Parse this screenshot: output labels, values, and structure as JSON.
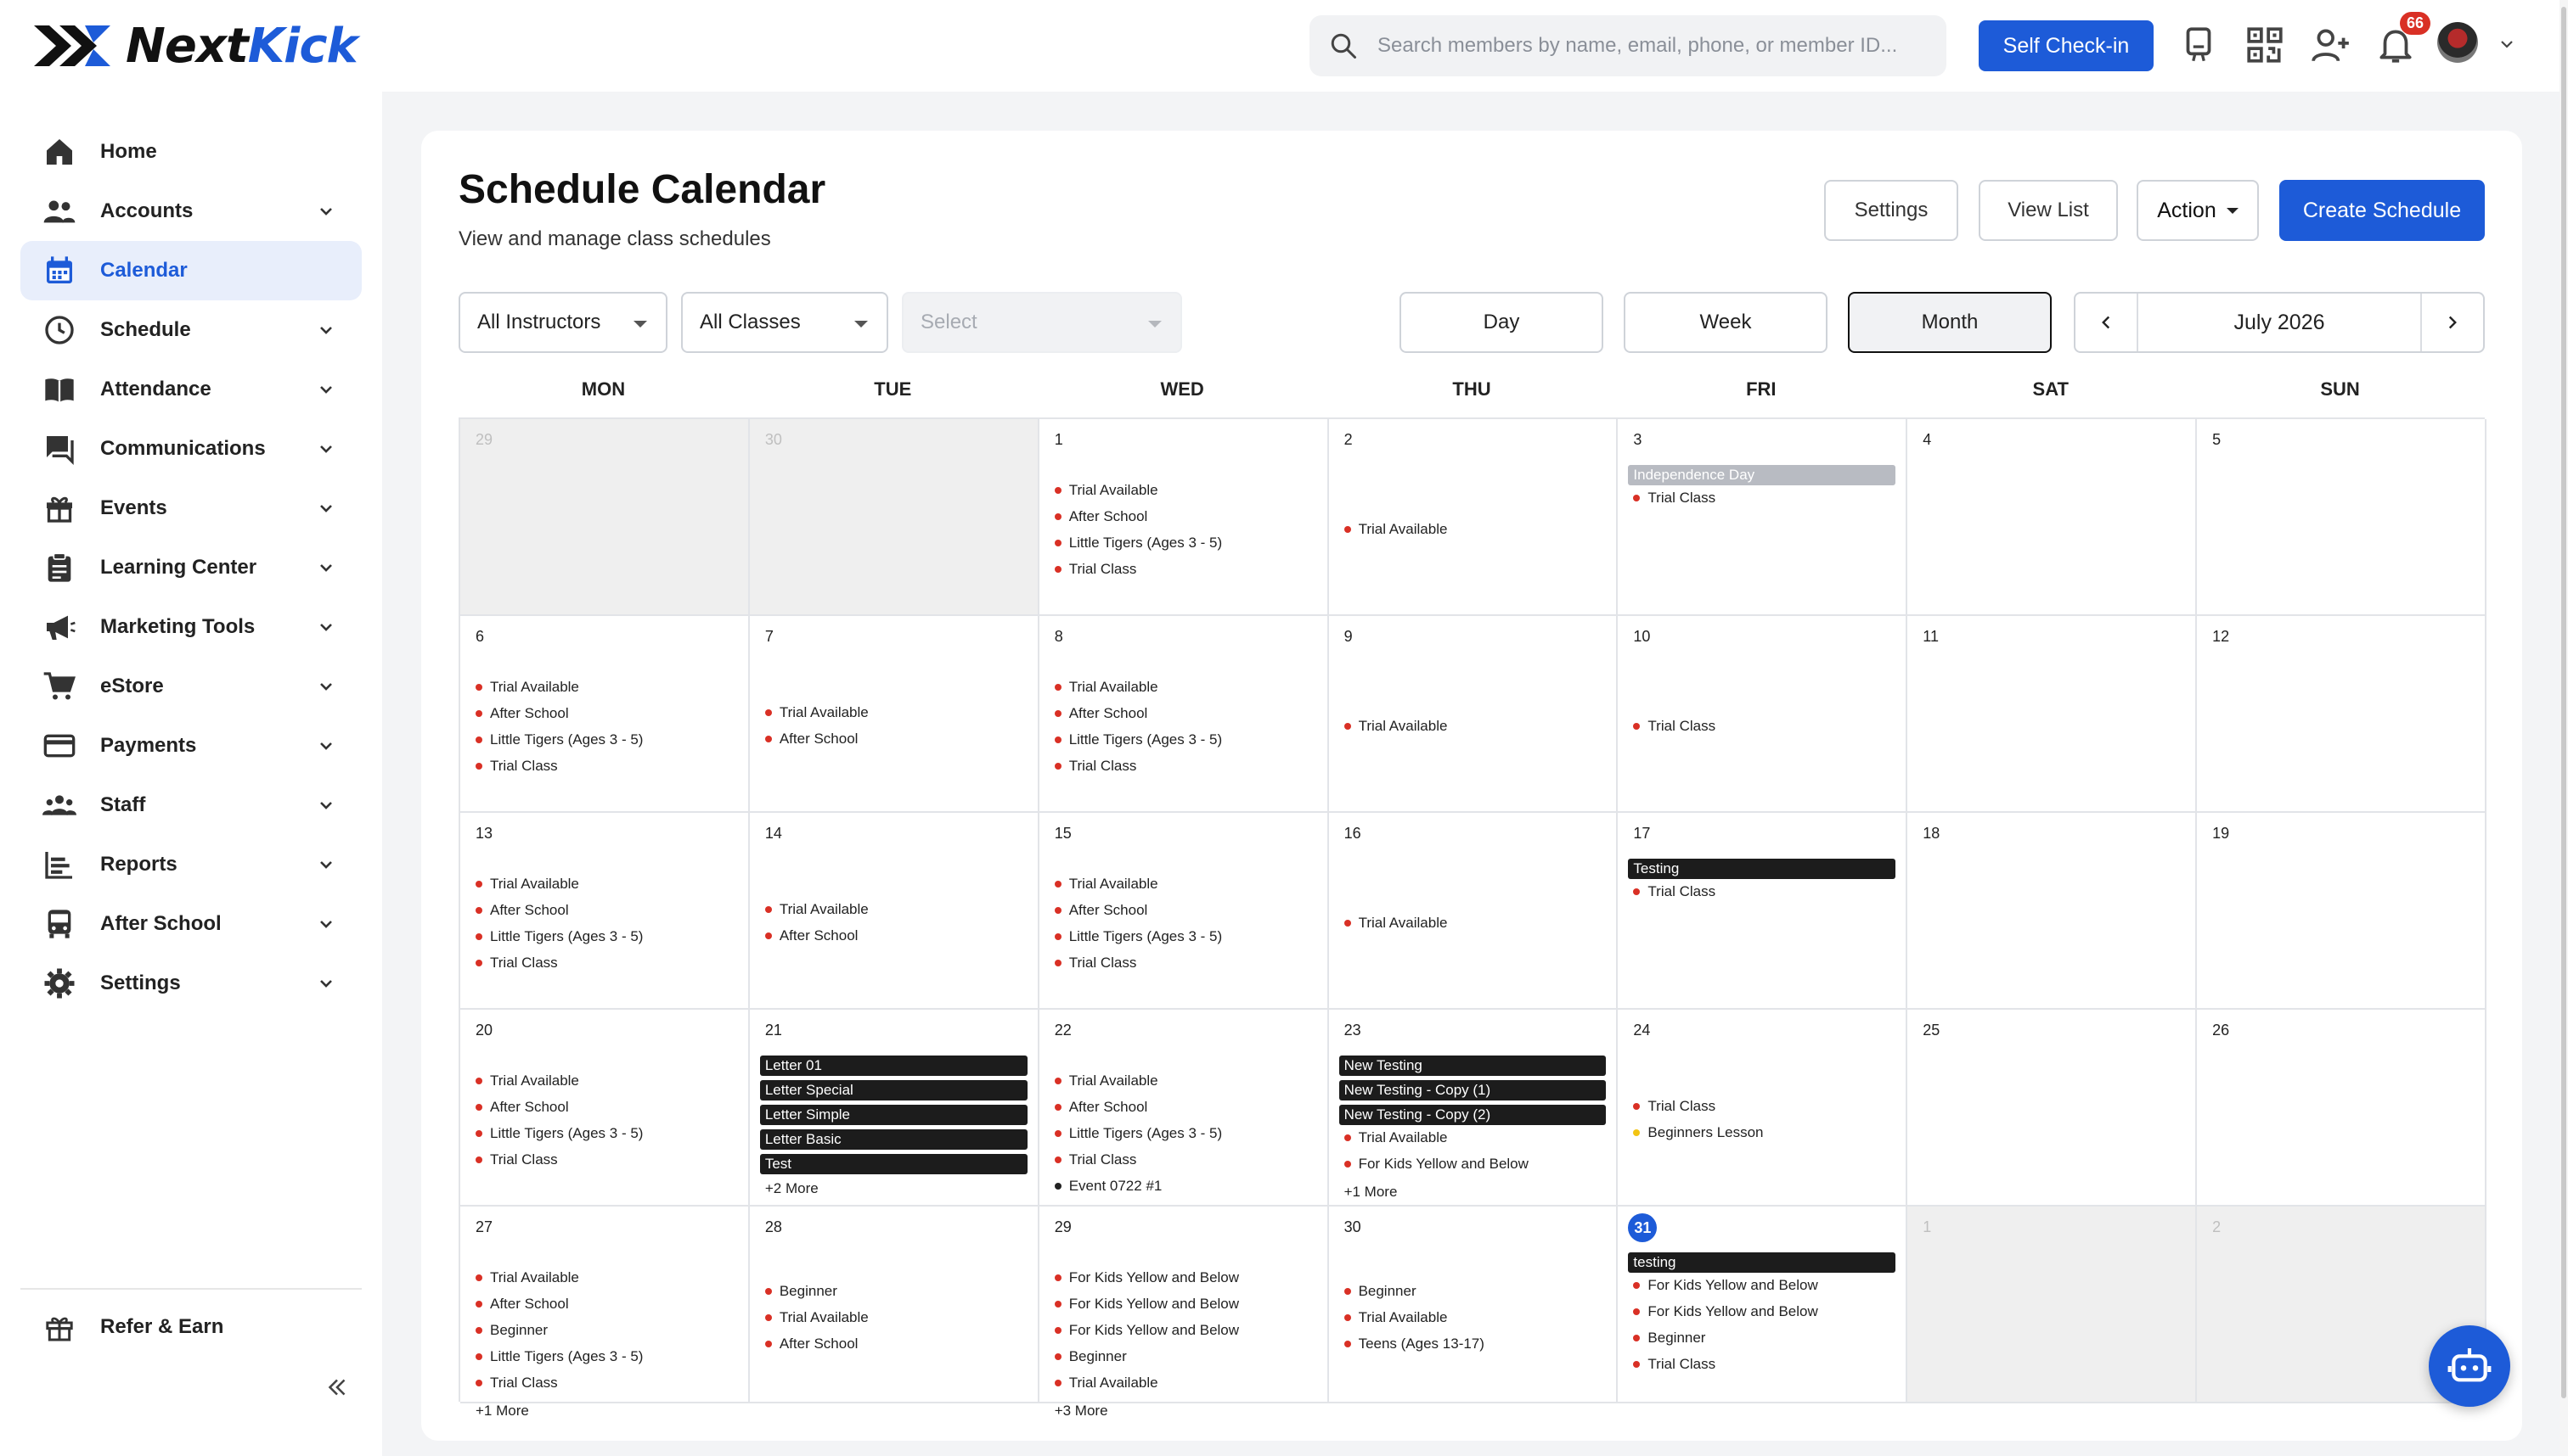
{
  "brand": {
    "name_part1": "Next",
    "name_part2": "Kick",
    "accent": "#1d5bd8"
  },
  "search": {
    "placeholder": "Search members by name, email, phone, or member ID..."
  },
  "topbar": {
    "checkin_label": "Self Check-in",
    "notifications_count": "66"
  },
  "sidebar": {
    "items": [
      {
        "label": "Home",
        "icon": "home-icon",
        "active": false,
        "expandable": false
      },
      {
        "label": "Accounts",
        "icon": "people-icon",
        "active": false,
        "expandable": true
      },
      {
        "label": "Calendar",
        "icon": "calendar-icon",
        "active": true,
        "expandable": false
      },
      {
        "label": "Schedule",
        "icon": "clock-icon",
        "active": false,
        "expandable": true
      },
      {
        "label": "Attendance",
        "icon": "book-icon",
        "active": false,
        "expandable": true
      },
      {
        "label": "Communications",
        "icon": "chat-icon",
        "active": false,
        "expandable": true
      },
      {
        "label": "Events",
        "icon": "gift-icon",
        "active": false,
        "expandable": true
      },
      {
        "label": "Learning Center",
        "icon": "clipboard-icon",
        "active": false,
        "expandable": true
      },
      {
        "label": "Marketing Tools",
        "icon": "megaphone-icon",
        "active": false,
        "expandable": true
      },
      {
        "label": "eStore",
        "icon": "cart-icon",
        "active": false,
        "expandable": true
      },
      {
        "label": "Payments",
        "icon": "card-icon",
        "active": false,
        "expandable": true
      },
      {
        "label": "Staff",
        "icon": "staff-icon",
        "active": false,
        "expandable": true
      },
      {
        "label": "Reports",
        "icon": "reports-icon",
        "active": false,
        "expandable": true
      },
      {
        "label": "After School",
        "icon": "bus-icon",
        "active": false,
        "expandable": true
      },
      {
        "label": "Settings",
        "icon": "gear-icon",
        "active": false,
        "expandable": true
      }
    ],
    "refer_label": "Refer & Earn"
  },
  "page": {
    "title": "Schedule Calendar",
    "subtitle": "View and manage class schedules",
    "settings_label": "Settings",
    "view_list_label": "View List",
    "action_label": "Action",
    "create_label": "Create Schedule"
  },
  "filters": {
    "instructors": "All Instructors",
    "classes": "All Classes",
    "third": "Select"
  },
  "views": {
    "day": "Day",
    "week": "Week",
    "month": "Month",
    "active": "month"
  },
  "month_label": "July 2026",
  "weekdays": [
    "MON",
    "TUE",
    "WED",
    "THU",
    "FRI",
    "SAT",
    "SUN"
  ],
  "weeks": [
    [
      {
        "day": "29",
        "out": true,
        "events": []
      },
      {
        "day": "30",
        "out": true,
        "events": []
      },
      {
        "day": "1",
        "events": [
          {
            "t": "dot",
            "label": "Trial Available"
          },
          {
            "t": "dot",
            "label": "After School"
          },
          {
            "t": "dot",
            "label": "Little Tigers (Ages 3 - 5)"
          },
          {
            "t": "dot",
            "label": "Trial Class"
          }
        ]
      },
      {
        "day": "2",
        "events": [
          {
            "t": "dot",
            "label": "Trial Available"
          }
        ]
      },
      {
        "day": "3",
        "events": [
          {
            "t": "bar",
            "style": "gray",
            "label": "Independence Day"
          },
          {
            "t": "dot",
            "label": "Trial Class"
          }
        ]
      },
      {
        "day": "4",
        "events": []
      },
      {
        "day": "5",
        "events": []
      }
    ],
    [
      {
        "day": "6",
        "events": [
          {
            "t": "dot",
            "label": "Trial Available"
          },
          {
            "t": "dot",
            "label": "After School"
          },
          {
            "t": "dot",
            "label": "Little Tigers (Ages 3 - 5)"
          },
          {
            "t": "dot",
            "label": "Trial Class"
          }
        ]
      },
      {
        "day": "7",
        "events": [
          {
            "t": "dot",
            "label": "Trial Available"
          },
          {
            "t": "dot",
            "label": "After School"
          }
        ]
      },
      {
        "day": "8",
        "events": [
          {
            "t": "dot",
            "label": "Trial Available"
          },
          {
            "t": "dot",
            "label": "After School"
          },
          {
            "t": "dot",
            "label": "Little Tigers (Ages 3 - 5)"
          },
          {
            "t": "dot",
            "label": "Trial Class"
          }
        ]
      },
      {
        "day": "9",
        "events": [
          {
            "t": "dot",
            "label": "Trial Available"
          }
        ]
      },
      {
        "day": "10",
        "events": [
          {
            "t": "dot",
            "label": "Trial Class"
          }
        ]
      },
      {
        "day": "11",
        "events": []
      },
      {
        "day": "12",
        "events": []
      }
    ],
    [
      {
        "day": "13",
        "events": [
          {
            "t": "dot",
            "label": "Trial Available"
          },
          {
            "t": "dot",
            "label": "After School"
          },
          {
            "t": "dot",
            "label": "Little Tigers (Ages 3 - 5)"
          },
          {
            "t": "dot",
            "label": "Trial Class"
          }
        ]
      },
      {
        "day": "14",
        "events": [
          {
            "t": "dot",
            "label": "Trial Available"
          },
          {
            "t": "dot",
            "label": "After School"
          }
        ]
      },
      {
        "day": "15",
        "events": [
          {
            "t": "dot",
            "label": "Trial Available"
          },
          {
            "t": "dot",
            "label": "After School"
          },
          {
            "t": "dot",
            "label": "Little Tigers (Ages 3 - 5)"
          },
          {
            "t": "dot",
            "label": "Trial Class"
          }
        ]
      },
      {
        "day": "16",
        "events": [
          {
            "t": "dot",
            "label": "Trial Available"
          }
        ]
      },
      {
        "day": "17",
        "events": [
          {
            "t": "bar",
            "label": "Testing"
          },
          {
            "t": "dot",
            "label": "Trial Class"
          }
        ]
      },
      {
        "day": "18",
        "events": []
      },
      {
        "day": "19",
        "events": []
      }
    ],
    [
      {
        "day": "20",
        "events": [
          {
            "t": "dot",
            "label": "Trial Available"
          },
          {
            "t": "dot",
            "label": "After School"
          },
          {
            "t": "dot",
            "label": "Little Tigers (Ages 3 - 5)"
          },
          {
            "t": "dot",
            "label": "Trial Class"
          }
        ]
      },
      {
        "day": "21",
        "events": [
          {
            "t": "bar",
            "label": "Letter 01"
          },
          {
            "t": "bar",
            "label": "Letter Special"
          },
          {
            "t": "bar",
            "label": "Letter Simple"
          },
          {
            "t": "bar",
            "label": "Letter Basic"
          },
          {
            "t": "bar",
            "label": "Test"
          }
        ],
        "more": "+2 More"
      },
      {
        "day": "22",
        "events": [
          {
            "t": "dot",
            "label": "Trial Available"
          },
          {
            "t": "dot",
            "label": "After School"
          },
          {
            "t": "dot",
            "label": "Little Tigers (Ages 3 - 5)"
          },
          {
            "t": "dot",
            "label": "Trial Class"
          },
          {
            "t": "dot",
            "color": "dark",
            "label": "Event 0722 #1"
          }
        ]
      },
      {
        "day": "23",
        "events": [
          {
            "t": "bar",
            "label": "New Testing"
          },
          {
            "t": "bar",
            "label": "New Testing - Copy (1)"
          },
          {
            "t": "bar",
            "label": "New Testing - Copy (2)"
          },
          {
            "t": "dot",
            "label": "Trial Available"
          },
          {
            "t": "dot",
            "label": "For Kids Yellow and Below"
          }
        ],
        "more": "+1 More"
      },
      {
        "day": "24",
        "events": [
          {
            "t": "dot",
            "label": "Trial Class"
          },
          {
            "t": "dot",
            "color": "yellow",
            "label": "Beginners Lesson"
          }
        ]
      },
      {
        "day": "25",
        "events": []
      },
      {
        "day": "26",
        "events": []
      }
    ],
    [
      {
        "day": "27",
        "events": [
          {
            "t": "dot",
            "label": "Trial Available"
          },
          {
            "t": "dot",
            "label": "After School"
          },
          {
            "t": "dot",
            "label": "Beginner"
          },
          {
            "t": "dot",
            "label": "Little Tigers (Ages 3 - 5)"
          },
          {
            "t": "dot",
            "label": "Trial Class"
          }
        ],
        "more": "+1 More"
      },
      {
        "day": "28",
        "events": [
          {
            "t": "dot",
            "label": "Beginner"
          },
          {
            "t": "dot",
            "label": "Trial Available"
          },
          {
            "t": "dot",
            "label": "After School"
          }
        ]
      },
      {
        "day": "29",
        "events": [
          {
            "t": "dot",
            "label": "For Kids Yellow and Below"
          },
          {
            "t": "dot",
            "label": "For Kids Yellow and Below"
          },
          {
            "t": "dot",
            "label": "For Kids Yellow and Below"
          },
          {
            "t": "dot",
            "label": "Beginner"
          },
          {
            "t": "dot",
            "label": "Trial Available"
          }
        ],
        "more": "+3 More"
      },
      {
        "day": "30",
        "events": [
          {
            "t": "dot",
            "label": "Beginner"
          },
          {
            "t": "dot",
            "label": "Trial Available"
          },
          {
            "t": "dot",
            "label": "Teens (Ages 13-17)"
          }
        ]
      },
      {
        "day": "31",
        "today": true,
        "events": [
          {
            "t": "bar",
            "label": "testing"
          },
          {
            "t": "dot",
            "label": "For Kids Yellow and Below"
          },
          {
            "t": "dot",
            "label": "For Kids Yellow and Below"
          },
          {
            "t": "dot",
            "label": "Beginner"
          },
          {
            "t": "dot",
            "label": "Trial Class"
          }
        ]
      },
      {
        "day": "1",
        "out": true,
        "events": []
      },
      {
        "day": "2",
        "out": true,
        "events": []
      }
    ]
  ]
}
